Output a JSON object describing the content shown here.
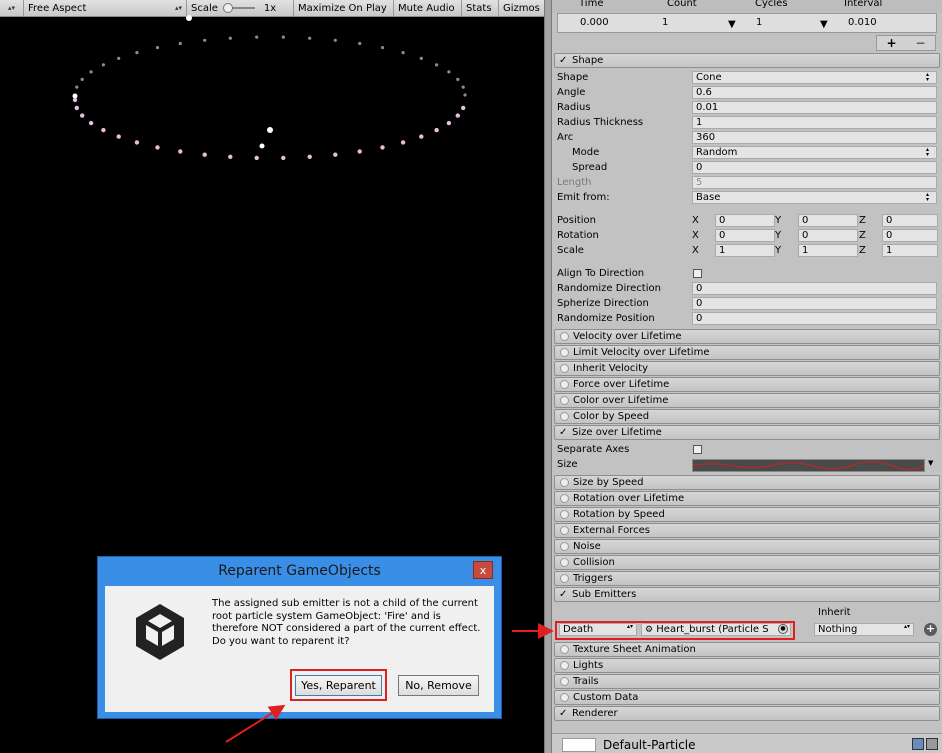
{
  "game_toolbar": {
    "display_label": "",
    "aspect": "Free Aspect",
    "scale_label": "Scale",
    "scale_value": "1x",
    "maximize": "Maximize On Play",
    "mute": "Mute Audio",
    "stats": "Stats",
    "gizmos": "Gizmos"
  },
  "emission": {
    "headers": [
      "Time",
      "Count",
      "Cycles",
      "Interval"
    ],
    "row": {
      "time": "0.000",
      "count": "1",
      "cycles": "1",
      "interval": "0.010"
    },
    "add": "+",
    "remove": "−"
  },
  "shape": {
    "title": "Shape",
    "shape_label": "Shape",
    "shape_value": "Cone",
    "angle_label": "Angle",
    "angle_value": "0.6",
    "radius_label": "Radius",
    "radius_value": "0.01",
    "thickness_label": "Radius Thickness",
    "thickness_value": "1",
    "arc_label": "Arc",
    "arc_value": "360",
    "mode_label": "Mode",
    "mode_value": "Random",
    "spread_label": "Spread",
    "spread_value": "0",
    "length_label": "Length",
    "length_value": "5",
    "emit_label": "Emit from:",
    "emit_value": "Base",
    "position_label": "Position",
    "rotation_label": "Rotation",
    "scale_label": "Scale",
    "x": "X",
    "y": "Y",
    "z": "Z",
    "position": [
      "0",
      "0",
      "0"
    ],
    "rotation": [
      "0",
      "0",
      "0"
    ],
    "scale": [
      "1",
      "1",
      "1"
    ],
    "align_label": "Align To Direction",
    "rand_dir_label": "Randomize Direction",
    "rand_dir_value": "0",
    "sph_dir_label": "Spherize Direction",
    "sph_dir_value": "0",
    "rand_pos_label": "Randomize Position",
    "rand_pos_value": "0"
  },
  "modules_a": [
    "Velocity over Lifetime",
    "Limit Velocity over Lifetime",
    "Inherit Velocity",
    "Force over Lifetime",
    "Color over Lifetime",
    "Color by Speed"
  ],
  "size_module": {
    "title": "Size over Lifetime",
    "separate_label": "Separate Axes",
    "size_label": "Size"
  },
  "modules_b": [
    "Size by Speed",
    "Rotation over Lifetime",
    "Rotation by Speed",
    "External Forces",
    "Noise",
    "Collision",
    "Triggers"
  ],
  "sub_emitters": {
    "title": "Sub Emitters",
    "inherit_label": "Inherit",
    "event": "Death",
    "emitter": "Heart_burst (Particle S",
    "inherit": "Nothing"
  },
  "modules_c": [
    "Texture Sheet Animation",
    "Lights",
    "Trails",
    "Custom Data"
  ],
  "renderer_title": "Renderer",
  "footer": {
    "material": "Default-Particle"
  },
  "dialog": {
    "title": "Reparent GameObjects",
    "message": "The assigned sub emitter is not a child of the current root particle system GameObject: 'Fire' and is therefore NOT considered a part of the current effect. Do you want to reparent it?",
    "yes": "Yes, Reparent",
    "no": "No, Remove",
    "close": "x"
  },
  "colors": {
    "highlight": "#e02020",
    "dialog_frame": "#3a8ee6",
    "particle": "#f0c8e8"
  }
}
